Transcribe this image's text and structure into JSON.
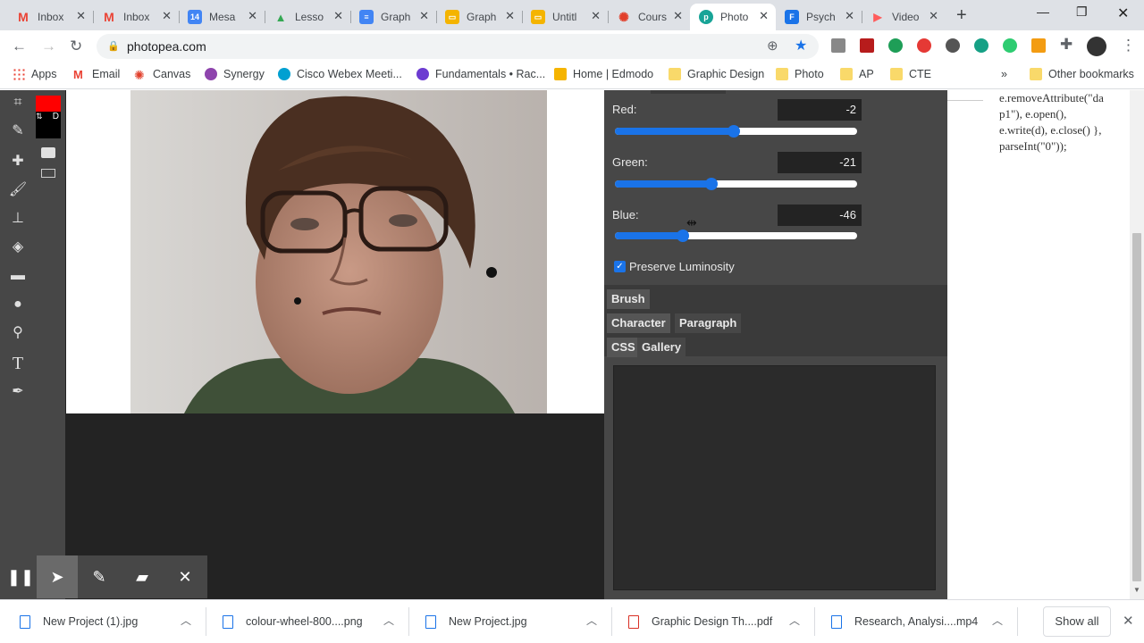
{
  "tabs": [
    {
      "label": "Inbox",
      "icon": "gmail-icon",
      "color": "#ea4335",
      "glyph": "M"
    },
    {
      "label": "Inbox",
      "icon": "gmail-icon",
      "color": "#ea4335",
      "glyph": "M"
    },
    {
      "label": "Mesa",
      "icon": "calendar-icon",
      "color": "#4285f4",
      "glyph": "14"
    },
    {
      "label": "Lesso",
      "icon": "drive-icon",
      "color": "#34a853",
      "glyph": "▲"
    },
    {
      "label": "Graph",
      "icon": "docs-icon",
      "color": "#4285f4",
      "glyph": "≡"
    },
    {
      "label": "Graph",
      "icon": "slides-icon",
      "color": "#f4b400",
      "glyph": "▭"
    },
    {
      "label": "Untitl",
      "icon": "slides-icon",
      "color": "#f4b400",
      "glyph": "▭"
    },
    {
      "label": "Cours",
      "icon": "canvas-icon",
      "color": "#e13f2b",
      "glyph": "✺"
    },
    {
      "label": "Photo",
      "icon": "photopea-icon",
      "color": "#18a497",
      "glyph": "p"
    },
    {
      "label": "Psych",
      "icon": "flipgrid-icon",
      "color": "#1a73e8",
      "glyph": "F"
    },
    {
      "label": "Video",
      "icon": "video-icon",
      "color": "#ff5c5c",
      "glyph": "▶"
    }
  ],
  "address": {
    "url": "photopea.com"
  },
  "bookmarks": [
    {
      "label": "Apps"
    },
    {
      "label": "Email"
    },
    {
      "label": "Canvas"
    },
    {
      "label": "Synergy"
    },
    {
      "label": "Cisco Webex Meeti..."
    },
    {
      "label": "Fundamentals • Rac..."
    },
    {
      "label": "Home | Edmodo"
    },
    {
      "label": "Graphic Design"
    },
    {
      "label": "Photo"
    },
    {
      "label": "AP"
    },
    {
      "label": "CTE"
    },
    {
      "label": "Other bookmarks"
    }
  ],
  "bookmarks_overflow": "»",
  "panel": {
    "red_label": "Red:",
    "red_value": "-2",
    "red_level": 0.49,
    "green_label": "Green:",
    "green_value": "-21",
    "green_level": 0.4,
    "blue_label": "Blue:",
    "blue_value": "-46",
    "blue_level": 0.28,
    "preserve_label": "Preserve Luminosity",
    "tab_brush": "Brush",
    "tab_character": "Character",
    "tab_paragraph": "Paragraph",
    "tab_css": "CSS",
    "tab_gallery": "Gallery"
  },
  "tools_d_label": "D",
  "code_text": "e.removeAttribute(\"da\np1\"), e.open(),\ne.write(d), e.close() },\nparseInt(\"0\"));",
  "downloads": [
    {
      "label": "New Project (1).jpg"
    },
    {
      "label": "colour-wheel-800....png"
    },
    {
      "label": "New Project.jpg"
    },
    {
      "label": "Graphic Design Th....pdf"
    },
    {
      "label": "Research, Analysi....mp4"
    }
  ],
  "show_all": "Show all",
  "colors": {
    "accent": "#1a73e8",
    "foreground_swatch": "#ff0000",
    "background_swatch": "#000000"
  }
}
